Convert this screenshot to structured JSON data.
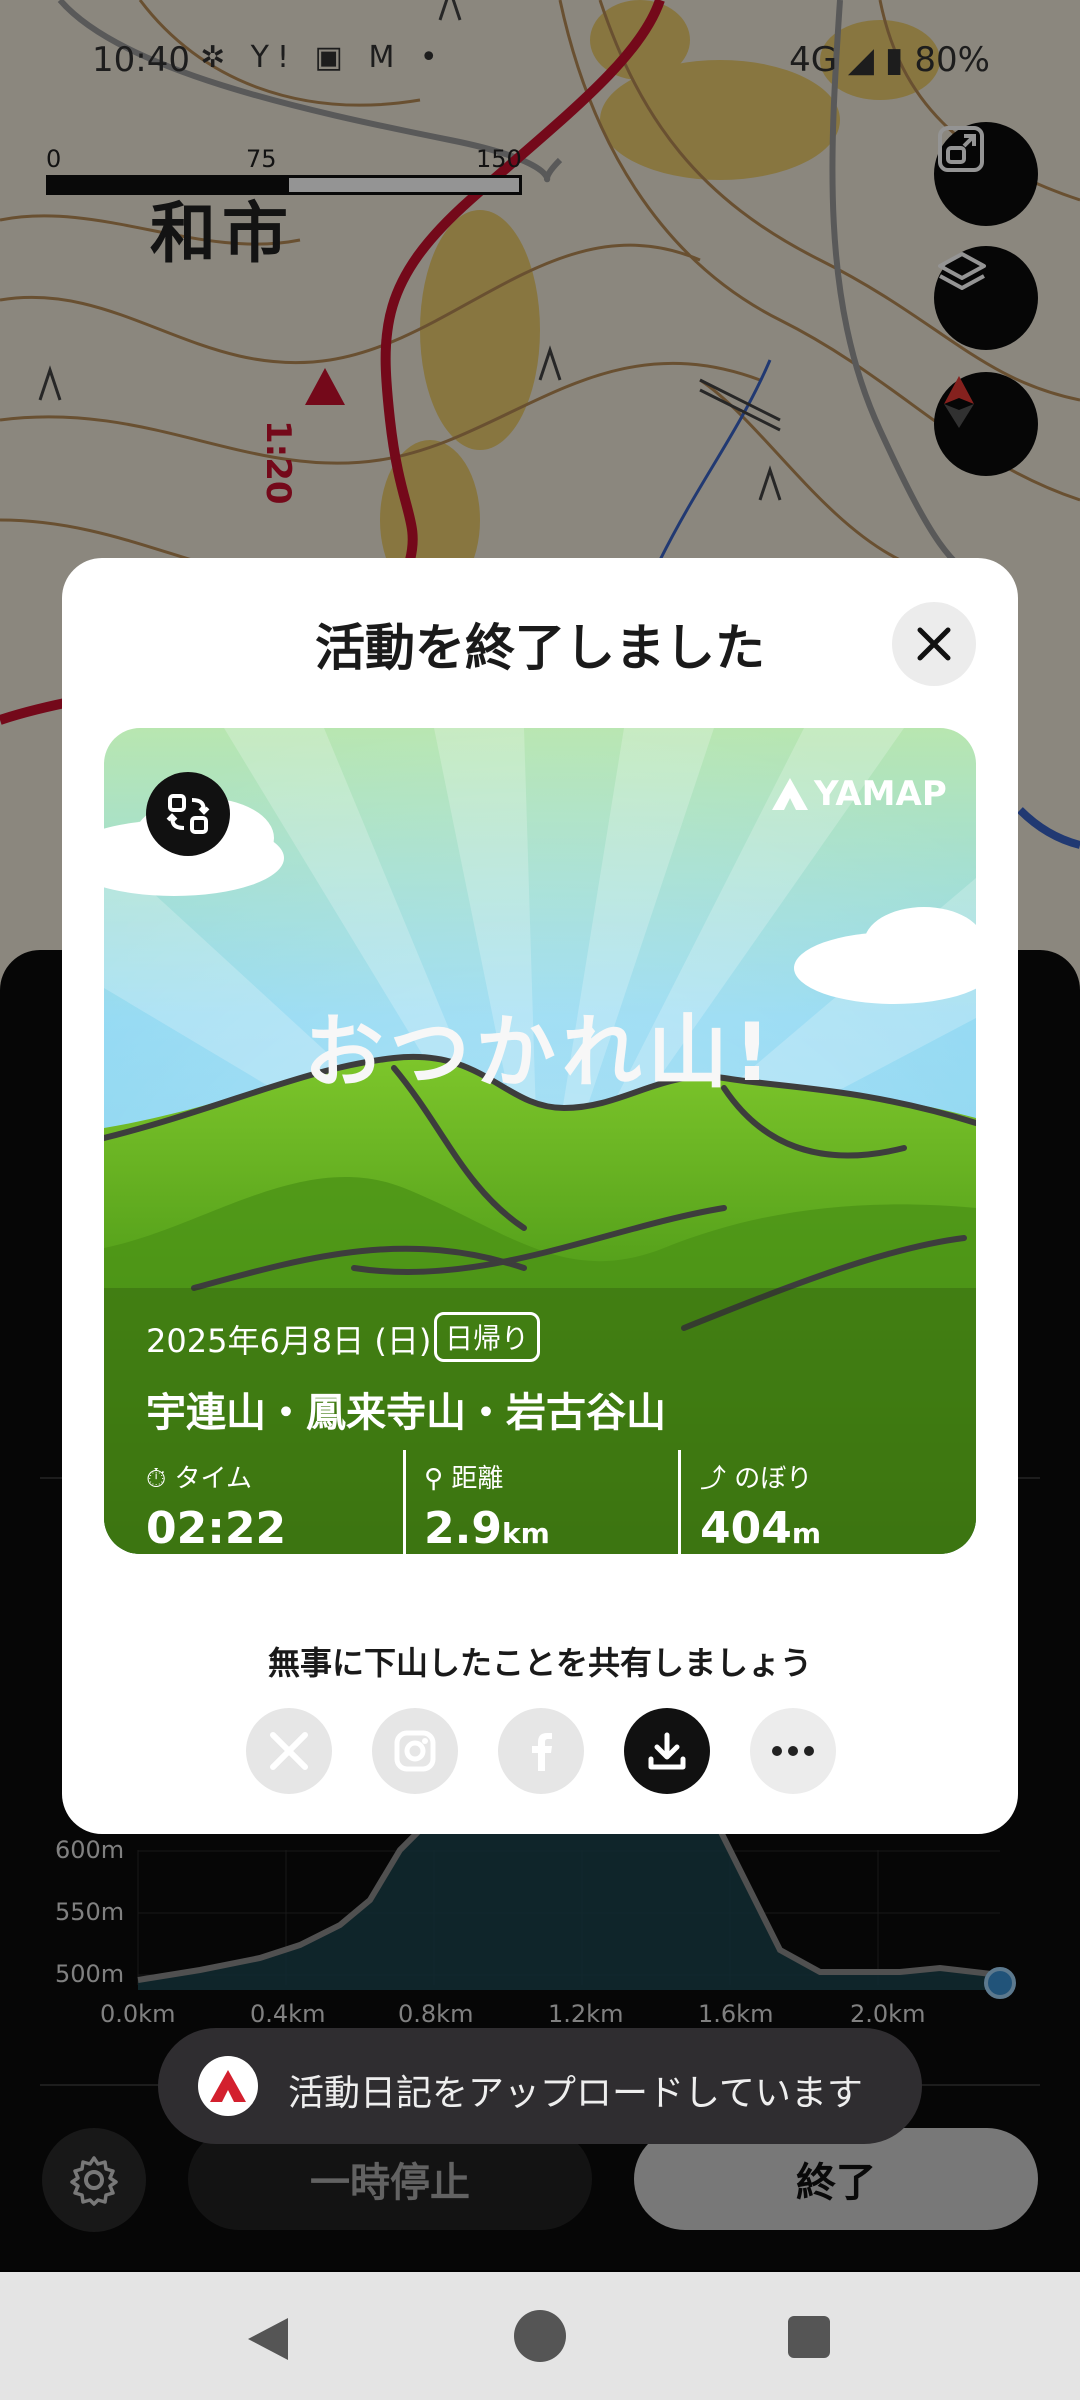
{
  "status_bar": {
    "time": "10:40",
    "network": "4G",
    "battery": "80%"
  },
  "map": {
    "scale_labels": [
      "0",
      "75 m",
      "150 m"
    ],
    "place_name": "和市",
    "route_marker": "1:20"
  },
  "dialog": {
    "title": "活動を終了しました",
    "card": {
      "brand": "YAMAP",
      "headline": "おつかれ山!",
      "date": "2025年6月8日 (日)",
      "trip_type": "日帰り",
      "mountains": "宇連山・鳳来寺山・岩古谷山",
      "stats": [
        {
          "label": "タイム",
          "value": "02:22",
          "unit": ""
        },
        {
          "label": "距離",
          "value": "2.9",
          "unit": "km"
        },
        {
          "label": "のぼり",
          "value": "404",
          "unit": "m"
        }
      ]
    },
    "share_message": "無事に下山したことを共有しましょう",
    "share_buttons": [
      "x-icon",
      "instagram-icon",
      "facebook-icon",
      "download-icon",
      "more-icon"
    ]
  },
  "elevation_chart": {
    "y_ticks": [
      "600m",
      "550m",
      "500m"
    ],
    "x_ticks": [
      "0.0km",
      "0.4km",
      "0.8km",
      "1.2km",
      "1.6km",
      "2.0km"
    ]
  },
  "bottom_controls": {
    "pause_label": "一時停止",
    "finish_label": "終了"
  },
  "toast": {
    "message": "活動日記をアップロードしています"
  },
  "colors": {
    "route_red": "#c8102e",
    "card_sky": "#7fd3f0",
    "card_grass": "#5aa51e",
    "accent_blue": "#3a8fd1"
  }
}
